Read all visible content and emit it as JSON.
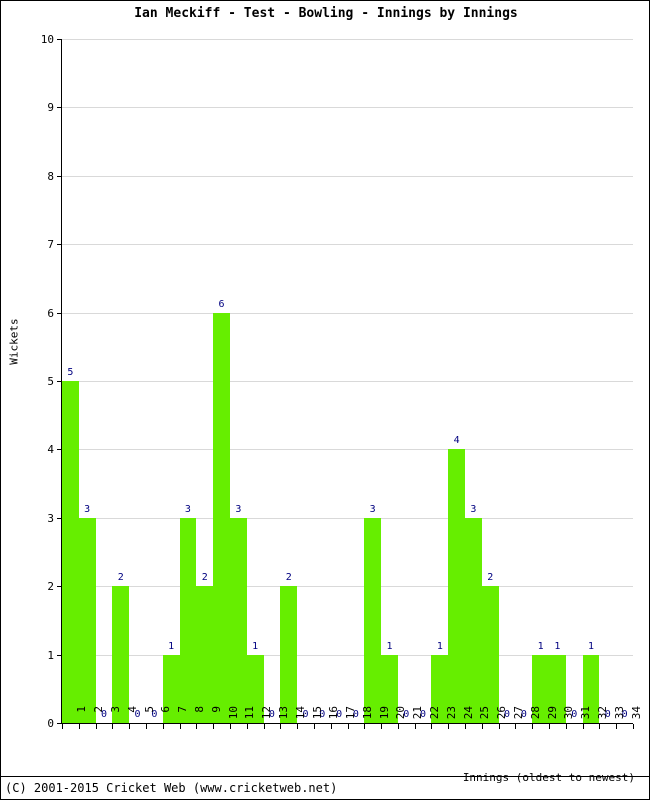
{
  "chart_data": {
    "type": "bar",
    "title": "Ian Meckiff - Test - Bowling - Innings by Innings",
    "xlabel": "Innings (oldest to newest)",
    "ylabel": "Wickets",
    "categories": [
      "1",
      "2",
      "3",
      "4",
      "5",
      "6",
      "7",
      "8",
      "9",
      "10",
      "11",
      "12",
      "13",
      "14",
      "15",
      "16",
      "17",
      "18",
      "19",
      "20",
      "21",
      "22",
      "23",
      "24",
      "25",
      "26",
      "27",
      "28",
      "29",
      "30",
      "31",
      "32",
      "33",
      "34"
    ],
    "values": [
      5,
      3,
      0,
      2,
      0,
      0,
      1,
      3,
      2,
      6,
      3,
      1,
      0,
      2,
      0,
      0,
      0,
      0,
      3,
      1,
      0,
      0,
      1,
      4,
      3,
      2,
      0,
      0,
      1,
      1,
      0,
      1,
      0,
      0
    ],
    "ylim": [
      0,
      10
    ],
    "yticks": [
      "0",
      "1",
      "2",
      "3",
      "4",
      "5",
      "6",
      "7",
      "8",
      "9",
      "10"
    ],
    "grid": true,
    "legend": false,
    "bar_color": "#66ee00",
    "label_color": "#000080",
    "gridline_color": "#d9d9d9",
    "axis_color": "#000000"
  },
  "footer": {
    "copyright": "(C) 2001-2015 Cricket Web (www.cricketweb.net)"
  }
}
